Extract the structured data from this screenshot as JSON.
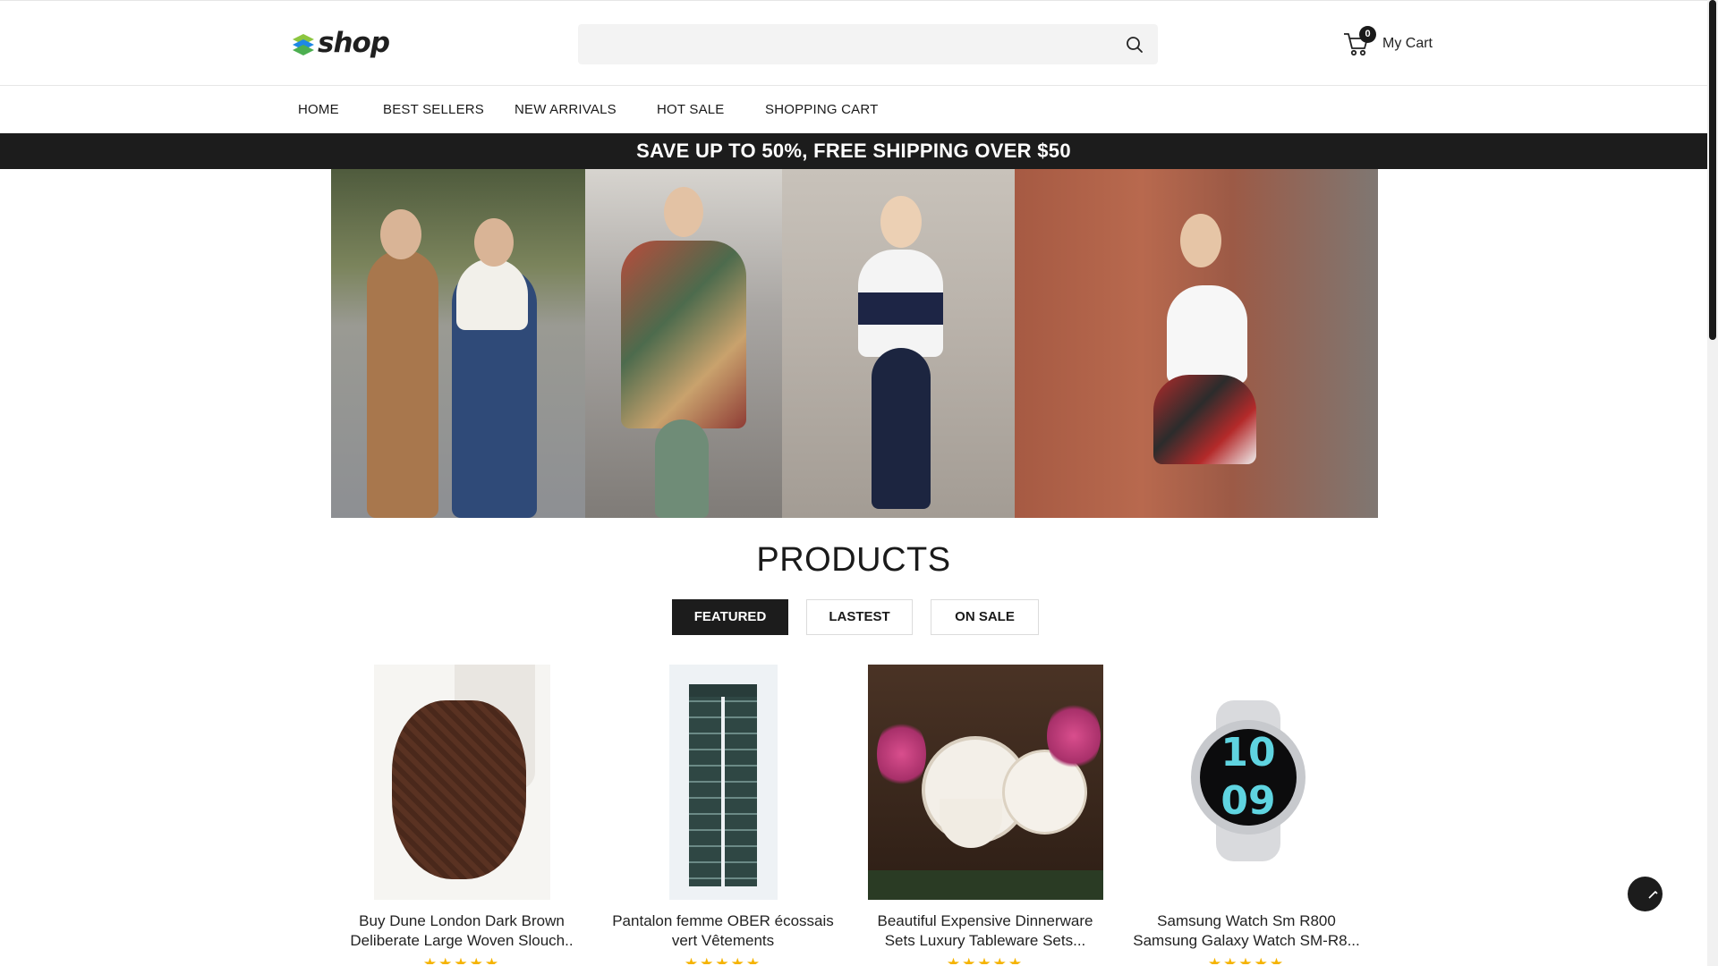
{
  "header": {
    "logo_text": "shop",
    "search": {
      "placeholder": ""
    },
    "cart": {
      "count": "0",
      "label": "My Cart"
    }
  },
  "nav": {
    "items": [
      {
        "label": "HOME"
      },
      {
        "label": "BEST SELLERS"
      },
      {
        "label": "NEW ARRIVALS"
      },
      {
        "label": "HOT SALE"
      },
      {
        "label": "SHOPPING CART"
      }
    ]
  },
  "promo": {
    "text": "SAVE UP TO 50%, FREE SHIPPING OVER $50"
  },
  "products_section": {
    "title": "PRODUCTS",
    "tabs": [
      {
        "label": "FEATURED",
        "active": true
      },
      {
        "label": "LASTEST",
        "active": false
      },
      {
        "label": "ON SALE",
        "active": false
      }
    ],
    "items": [
      {
        "title_line1": "Buy Dune London Dark Brown",
        "title_line2": "Deliberate Large Woven Slouch..",
        "rating": "★★★★★"
      },
      {
        "title_line1": "Pantalon femme OBER écossais",
        "title_line2": "vert Vêtements",
        "rating": "★★★★★"
      },
      {
        "title_line1": "Beautiful Expensive Dinnerware",
        "title_line2": "Sets Luxury Tableware Sets...",
        "rating": "★★★★★"
      },
      {
        "title_line1": "Samsung Watch Sm R800",
        "title_line2": "Samsung Galaxy Watch SM-R8...",
        "rating": "★★★★★"
      }
    ]
  },
  "colors": {
    "dark": "#1c1c1c",
    "star": "#f5b301",
    "logo_green": "#8cc63f",
    "logo_blue": "#1e88e5"
  },
  "icons": [
    "search-icon",
    "cart-icon",
    "chevron-up-icon"
  ]
}
